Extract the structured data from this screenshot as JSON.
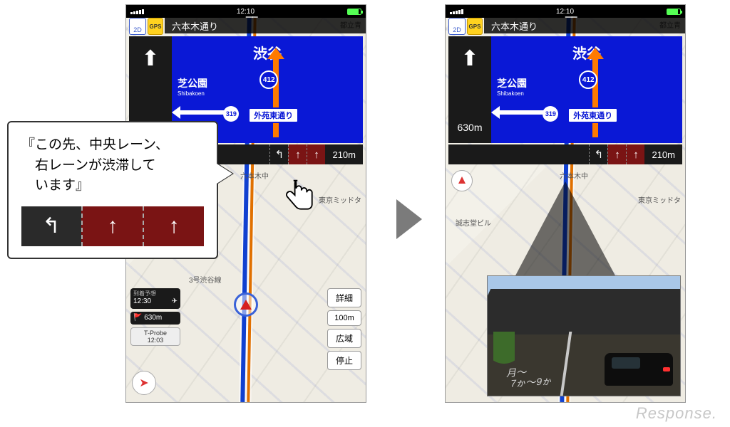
{
  "status": {
    "time": "12:10"
  },
  "road_label": "六本木通り",
  "btn2d": "2D",
  "btngps": "GPS",
  "sign": {
    "dest_top": "渋谷",
    "dest_left": "芝公園",
    "dest_left_en": "Shibakoen",
    "route_main": "412",
    "route_cross": "319",
    "cross_name": "外苑東通り"
  },
  "left": {
    "sign_distance": "",
    "lane_distance": "210m",
    "arrival_label": "到着予想",
    "arrival_time": "12:30",
    "remaining": "630m",
    "tprobe": "T-Probe",
    "tprobe_time": "12:03"
  },
  "right": {
    "sign_distance": "630m",
    "road_text": "月〜\n  7ゕ〜9ゕ"
  },
  "mapbtns": {
    "detail": "詳細",
    "scale": "100m",
    "wide": "広域",
    "stop": "停止"
  },
  "maptext": {
    "roppongi": "六本木中",
    "midtown": "東京ミッドタ",
    "seishido": "誠志堂ビル",
    "shibuya_line": "3号渋谷線",
    "aoyama": "都立青"
  },
  "callout": {
    "l1": "『この先、中央レーン、",
    "l2": "　右レーンが渋滞して",
    "l3": "　います』"
  },
  "lane_glyphs": {
    "turn": "↰",
    "up": "↑"
  },
  "watermark": "Response."
}
